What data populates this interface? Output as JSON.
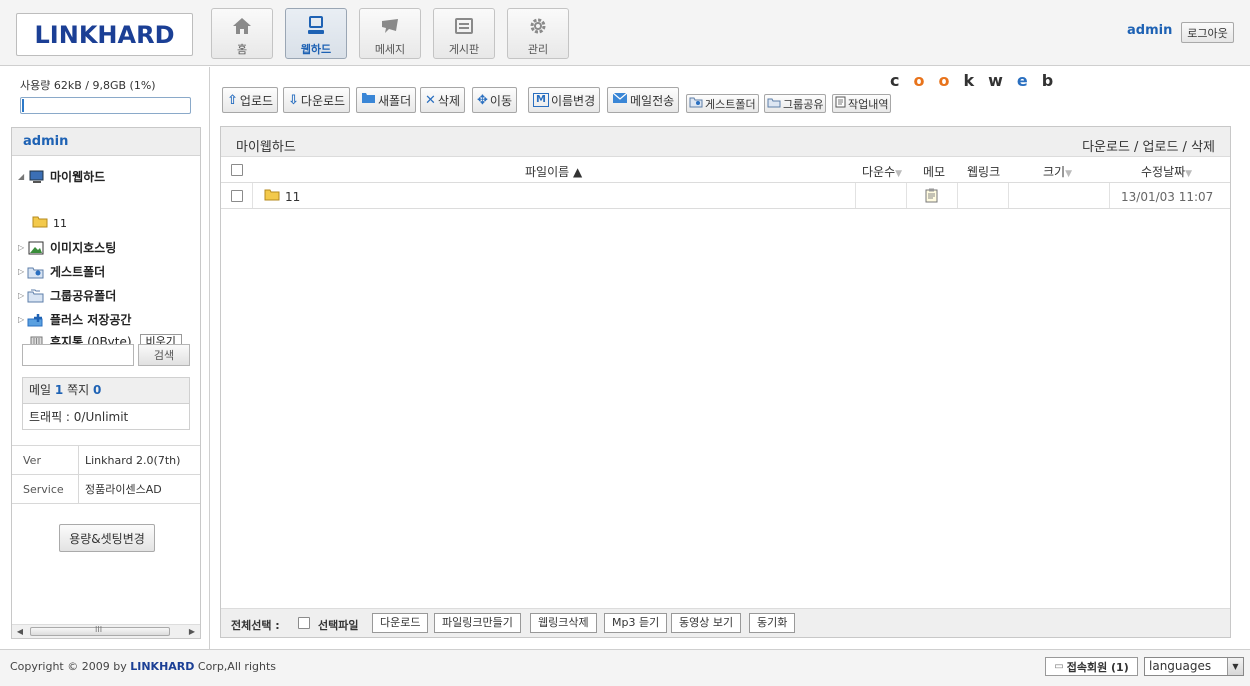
{
  "header": {
    "logo_text": "LINKHARD",
    "nav": [
      {
        "label": "홈",
        "icon": "home-icon"
      },
      {
        "label": "웹하드",
        "icon": "computer-icon",
        "active": true
      },
      {
        "label": "메세지",
        "icon": "message-icon"
      },
      {
        "label": "게시판",
        "icon": "board-icon"
      },
      {
        "label": "관리",
        "icon": "gear-icon"
      }
    ],
    "user": "admin",
    "logout_label": "로그아웃"
  },
  "usage": {
    "text": "사용량 62kB / 9,8GB (1%)",
    "percent": 1
  },
  "sidebar": {
    "title": "admin",
    "tree": {
      "my_webhard": "마이웹하드",
      "sub_folder": "11",
      "image_hosting": "이미지호스팅",
      "guest_folder": "게스트폴더",
      "group_folder": "그룹공유폴더",
      "plus_storage": "플러스 저장공간",
      "trash": "휴지통",
      "trash_size": "(0Byte)",
      "empty_label": "비우기"
    },
    "search_label": "검색",
    "mail_label": "메일",
    "mail_count": "1",
    "note_label": "쪽지",
    "note_count": "0",
    "traffic": "트래픽 : 0/Unlimit",
    "info": [
      {
        "key": "Ver",
        "value": "Linkhard 2.0(7th)"
      },
      {
        "key": "Service",
        "value": "정품라이센스AD"
      }
    ],
    "setting_label": "용량&셋팅변경",
    "scroll_label": "III"
  },
  "toolbar": {
    "upload": "업로드",
    "download": "다운로드",
    "new_folder": "새폴더",
    "delete": "삭제",
    "move": "이동",
    "rename": "이름변경",
    "email_send": "메일전송",
    "guest_folder": "게스트폴더",
    "group_share": "그룹공유",
    "work_history": "작업내역"
  },
  "cookweb": {
    "letters": [
      "c",
      "oo",
      "k",
      "w",
      "e",
      "b"
    ],
    "colors": [
      "#333333",
      "#e8731b",
      "#333333",
      "#333333",
      "#2a6fc0",
      "#333333"
    ]
  },
  "main": {
    "title": "마이웹하드",
    "links": "다운로드 / 업로드 / 삭제",
    "columns": {
      "filename": "파일이름 ▲",
      "downloads": "다운수",
      "memo": "메모",
      "weblink": "웹링크",
      "size": "크기",
      "modified": "수정날짜"
    },
    "rows": [
      {
        "name": "11",
        "modified": "13/01/03 11:07"
      }
    ]
  },
  "bottombar": {
    "select_all": "전체선택 :",
    "selected_files": "선택파일",
    "buttons": [
      "다운로드",
      "파일링크만들기",
      "웹링크삭제",
      "Mp3 듣기",
      "동영상 보기",
      "동기화"
    ]
  },
  "footer": {
    "copyright_pre": "Copyright © 2009 by",
    "copyright_brand": "LINKHARD",
    "copyright_post": "Corp,All rights",
    "online_label": "접속회원 (1)",
    "language": "languages"
  }
}
